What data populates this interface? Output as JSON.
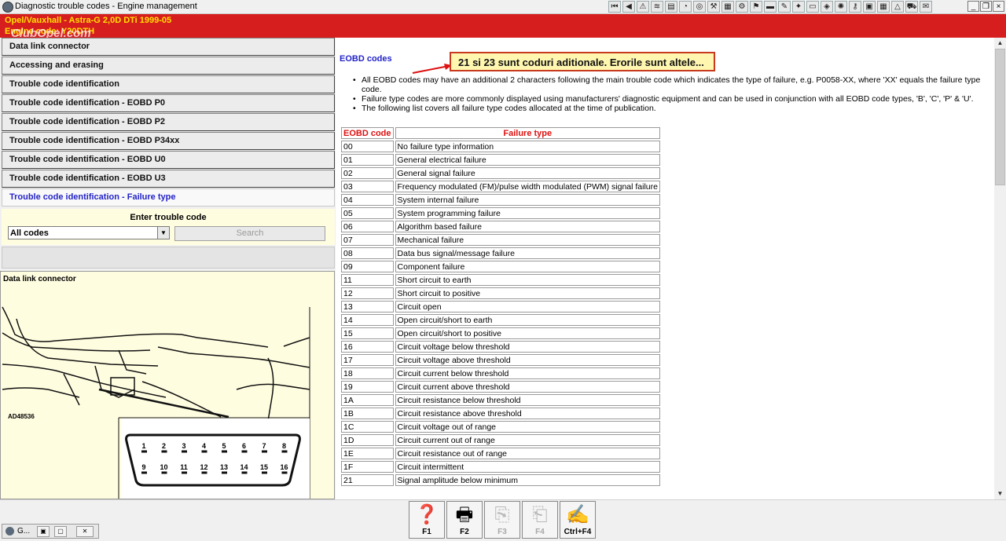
{
  "window": {
    "title": "Diagnostic trouble codes - Engine management",
    "toolbar_icons": [
      "first-icon",
      "previous-icon",
      "warning-icon",
      "wiring-icon",
      "book-icon",
      "gauge-icon",
      "wheel-icon",
      "tools-icon",
      "chart-icon",
      "engine-icon",
      "flag-icon",
      "car-icon",
      "wrench-icon",
      "tune-icon",
      "monitor-icon",
      "car-service-icon",
      "lamp-icon",
      "key-icon",
      "document-icon",
      "calculator-icon",
      "triangle-icon",
      "vehicle-icon",
      "note-icon"
    ],
    "controls": {
      "minimize": "_",
      "restore": "❐",
      "close": "×"
    }
  },
  "banner": {
    "vehicle": "Opel/Vauxhall - Astra-G  2,0D DTi 1999-05",
    "engine": "Engine code: Y20DTH",
    "watermark": "ClubOpel.com"
  },
  "nav": {
    "items": [
      "Data link connector",
      "Accessing and erasing",
      "Trouble code identification",
      "Trouble code identification - EOBD P0",
      "Trouble code identification - EOBD P2",
      "Trouble code identification - EOBD P34xx",
      "Trouble code identification - EOBD U0",
      "Trouble code identification - EOBD U3",
      "Trouble code identification - Failure type"
    ],
    "active_index": 8
  },
  "search": {
    "label": "Enter trouble code",
    "select_value": "All codes",
    "button": "Search"
  },
  "diagram": {
    "title": "Data link connector",
    "ref": "AD48536",
    "pins_top": [
      "1",
      "2",
      "3",
      "4",
      "5",
      "6",
      "7",
      "8"
    ],
    "pins_bottom": [
      "9",
      "10",
      "11",
      "12",
      "13",
      "14",
      "15",
      "16"
    ]
  },
  "content": {
    "section_title": "EOBD codes",
    "callout": "21 si 23 sunt coduri aditionale. Erorile sunt altele...",
    "bullets": [
      "All EOBD codes may have an additional 2 characters following the main trouble code which indicates the type of failure, e.g. P0058-XX, where 'XX' equals the failure type code.",
      "Failure type codes are more commonly displayed using manufacturers' diagnostic equipment and can be used in conjunction with all EOBD code types, 'B', 'C', 'P' & 'U'.",
      "The following list covers all failure type codes allocated at the time of publication."
    ],
    "table": {
      "headers": [
        "EOBD code",
        "Failure type"
      ],
      "rows": [
        [
          "00",
          "No failure type information"
        ],
        [
          "01",
          "General electrical failure"
        ],
        [
          "02",
          "General signal failure"
        ],
        [
          "03",
          "Frequency modulated (FM)/pulse width modulated (PWM) signal failure"
        ],
        [
          "04",
          "System internal failure"
        ],
        [
          "05",
          "System programming failure"
        ],
        [
          "06",
          "Algorithm based failure"
        ],
        [
          "07",
          "Mechanical failure"
        ],
        [
          "08",
          "Data bus signal/message failure"
        ],
        [
          "09",
          "Component failure"
        ],
        [
          "11",
          "Short circuit to earth"
        ],
        [
          "12",
          "Short circuit to positive"
        ],
        [
          "13",
          "Circuit open"
        ],
        [
          "14",
          "Open circuit/short to earth"
        ],
        [
          "15",
          "Open circuit/short to positive"
        ],
        [
          "16",
          "Circuit voltage below threshold"
        ],
        [
          "17",
          "Circuit voltage above threshold"
        ],
        [
          "18",
          "Circuit current below threshold"
        ],
        [
          "19",
          "Circuit current above threshold"
        ],
        [
          "1A",
          "Circuit resistance below threshold"
        ],
        [
          "1B",
          "Circuit resistance above threshold"
        ],
        [
          "1C",
          "Circuit voltage out of range"
        ],
        [
          "1D",
          "Circuit current out of range"
        ],
        [
          "1E",
          "Circuit resistance out of range"
        ],
        [
          "1F",
          "Circuit intermittent"
        ],
        [
          "21",
          "Signal amplitude below minimum"
        ]
      ]
    }
  },
  "fkeys": [
    {
      "label": "F1",
      "icon": "help-icon",
      "enabled": true
    },
    {
      "label": "F2",
      "icon": "print-icon",
      "enabled": true
    },
    {
      "label": "F3",
      "icon": "copy-icon",
      "enabled": false
    },
    {
      "label": "F4",
      "icon": "paste-icon",
      "enabled": false
    },
    {
      "label": "Ctrl+F4",
      "icon": "notes-icon",
      "enabled": true
    }
  ],
  "taskbar": {
    "label": "G..."
  }
}
